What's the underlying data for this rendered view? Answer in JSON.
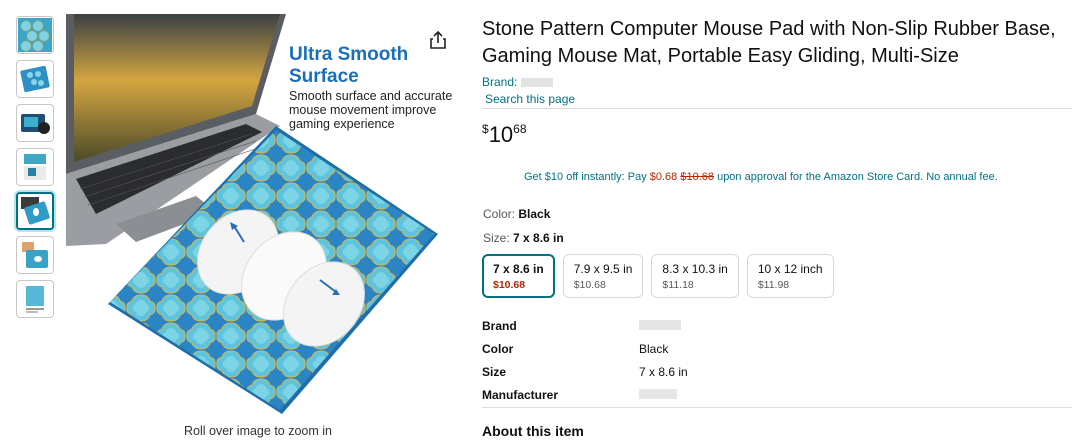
{
  "product": {
    "title": "Stone Pattern Computer Mouse Pad with Non-Slip Rubber Base, Gaming Mouse Mat, Portable Easy Gliding, Multi-Size",
    "brand_label": "Brand:",
    "search_store": "Search this page",
    "price_symbol": "$",
    "price_whole": "10",
    "price_fraction": "68"
  },
  "promo": {
    "part1": "Get $10 off instantly: Pay ",
    "new_price": "$0.68",
    "old_price": "$10.68",
    "part2": " upon approval for the Amazon Store Card. No annual fee."
  },
  "image": {
    "headline": "Ultra Smooth Surface",
    "description": "Smooth surface and accurate mouse movement improve gaming experience",
    "zoom_hint": "Roll over image to zoom in"
  },
  "color": {
    "label": "Color: ",
    "value": "Black"
  },
  "size": {
    "label": "Size: ",
    "value": "7 x 8.6 in",
    "options": [
      {
        "name": "7 x 8.6 in",
        "price": "$10.68"
      },
      {
        "name": "7.9 x 9.5 in",
        "price": "$10.68"
      },
      {
        "name": "8.3 x 10.3 in",
        "price": "$11.18"
      },
      {
        "name": "10 x 12 inch",
        "price": "$11.98"
      }
    ]
  },
  "specs": [
    {
      "key": "Brand",
      "value": ""
    },
    {
      "key": "Color",
      "value": "Black"
    },
    {
      "key": "Size",
      "value": "7 x 8.6 in"
    },
    {
      "key": "Manufacturer",
      "value": ""
    }
  ],
  "about_heading": "About this item",
  "colors": {
    "link": "#007185",
    "price_red": "#b12704",
    "headline_blue": "#1b6fb8"
  },
  "icons": [
    "share-icon"
  ]
}
